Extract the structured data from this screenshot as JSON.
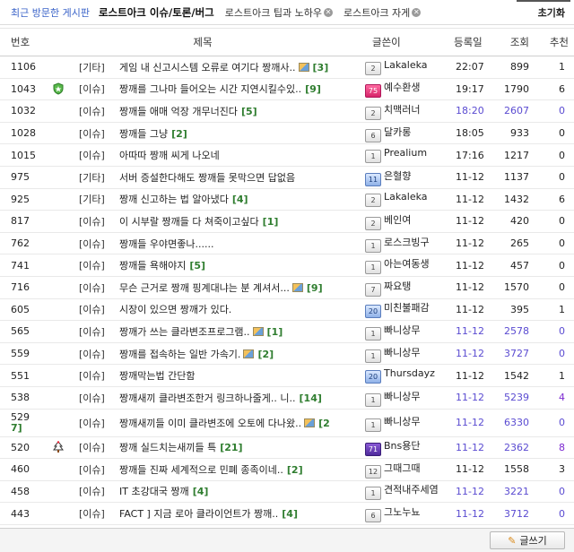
{
  "topbar": {
    "recent_label": "최근 방문한 게시판",
    "current_tab": "로스트아크 이슈/토론/버그",
    "tabs": [
      {
        "label": "로스트아크 팁과 노하우"
      },
      {
        "label": "로스트아크 자게"
      }
    ],
    "reset_label": "초기화"
  },
  "headers": {
    "num": "번호",
    "title": "제목",
    "writer": "글쓴이",
    "date": "등록일",
    "views": "조회",
    "rec": "추천"
  },
  "rows": [
    {
      "num": "1106",
      "cat": "[기타]",
      "title": "게임 내 신고시스템 오류로 여기다 짱깨사..",
      "comments": "[3]",
      "img": true,
      "badge": "",
      "writer": "Lakaleka",
      "lvl": "2",
      "lvl_style": "",
      "date": "22:07",
      "date_style": "",
      "views": "899",
      "views_style": "",
      "rec": "1",
      "rec_style": ""
    },
    {
      "num": "1043",
      "cat": "[이슈]",
      "title": "짱깨를 그나마 들어오는 시간 지연시킬수있..",
      "comments": "[9]",
      "img": false,
      "badge": "shield",
      "writer": "예수환생",
      "lvl": "75",
      "lvl_style": "pink",
      "date": "19:17",
      "date_style": "",
      "views": "1790",
      "views_style": "",
      "rec": "6",
      "rec_style": ""
    },
    {
      "num": "1032",
      "cat": "[이슈]",
      "title": "짱깨들 애매 억장 개무너진다",
      "comments": "[5]",
      "img": false,
      "badge": "",
      "writer": "치맥러너",
      "lvl": "2",
      "lvl_style": "",
      "date": "18:20",
      "date_style": "blue",
      "views": "2607",
      "views_style": "blue",
      "rec": "0",
      "rec_style": "blue"
    },
    {
      "num": "1028",
      "cat": "[이슈]",
      "title": "짱깨들 그냥",
      "comments": "[2]",
      "img": false,
      "badge": "",
      "writer": "달카롱",
      "lvl": "6",
      "lvl_style": "",
      "date": "18:05",
      "date_style": "",
      "views": "933",
      "views_style": "",
      "rec": "0",
      "rec_style": ""
    },
    {
      "num": "1015",
      "cat": "[이슈]",
      "title": "아따따 짱깨 씨게 나오네",
      "comments": "",
      "img": false,
      "badge": "",
      "writer": "Prealium",
      "lvl": "1",
      "lvl_style": "",
      "date": "17:16",
      "date_style": "",
      "views": "1217",
      "views_style": "",
      "rec": "0",
      "rec_style": ""
    },
    {
      "num": "975",
      "cat": "[기타]",
      "title": "서버 증설한다해도 짱깨들 못막으면 답없음",
      "comments": "",
      "img": false,
      "badge": "",
      "writer": "은혈향",
      "lvl": "11",
      "lvl_style": "blue",
      "date": "11-12",
      "date_style": "",
      "views": "1137",
      "views_style": "",
      "rec": "0",
      "rec_style": ""
    },
    {
      "num": "925",
      "cat": "[기타]",
      "title": "짱깨 신고하는 법 알아냈다",
      "comments": "[4]",
      "img": false,
      "badge": "",
      "writer": "Lakaleka",
      "lvl": "2",
      "lvl_style": "",
      "date": "11-12",
      "date_style": "",
      "views": "1432",
      "views_style": "",
      "rec": "6",
      "rec_style": ""
    },
    {
      "num": "817",
      "cat": "[이슈]",
      "title": "이 시부랄 짱깨들 다 쳐죽이고싶다",
      "comments": "[1]",
      "img": false,
      "badge": "",
      "writer": "베인여",
      "lvl": "2",
      "lvl_style": "",
      "date": "11-12",
      "date_style": "",
      "views": "420",
      "views_style": "",
      "rec": "0",
      "rec_style": ""
    },
    {
      "num": "762",
      "cat": "[이슈]",
      "title": "짱깨들 우야면좋나......",
      "comments": "",
      "img": false,
      "badge": "",
      "writer": "로스크빙구",
      "lvl": "1",
      "lvl_style": "",
      "date": "11-12",
      "date_style": "",
      "views": "265",
      "views_style": "",
      "rec": "0",
      "rec_style": ""
    },
    {
      "num": "741",
      "cat": "[이슈]",
      "title": "짱깨들 욕해야지",
      "comments": "[5]",
      "img": false,
      "badge": "",
      "writer": "아는여동생",
      "lvl": "1",
      "lvl_style": "",
      "date": "11-12",
      "date_style": "",
      "views": "457",
      "views_style": "",
      "rec": "0",
      "rec_style": ""
    },
    {
      "num": "716",
      "cat": "[이슈]",
      "title": "무슨 근거로 짱깨 핑계대냐는 분 계셔서...",
      "comments": "[9]",
      "img": true,
      "badge": "",
      "writer": "짜요탱",
      "lvl": "7",
      "lvl_style": "",
      "date": "11-12",
      "date_style": "",
      "views": "1570",
      "views_style": "",
      "rec": "0",
      "rec_style": ""
    },
    {
      "num": "605",
      "cat": "[이슈]",
      "title": "시장이 있으면 짱깨가 있다.",
      "comments": "",
      "img": false,
      "badge": "",
      "writer": "미친불패감",
      "lvl": "20",
      "lvl_style": "blue",
      "date": "11-12",
      "date_style": "",
      "views": "395",
      "views_style": "",
      "rec": "1",
      "rec_style": ""
    },
    {
      "num": "565",
      "cat": "[이슈]",
      "title": "짱깨가 쓰는 클라변조프로그램..",
      "comments": "[1]",
      "img": true,
      "badge": "",
      "writer": "빠니상무",
      "lvl": "1",
      "lvl_style": "",
      "date": "11-12",
      "date_style": "blue",
      "views": "2578",
      "views_style": "blue",
      "rec": "0",
      "rec_style": "blue"
    },
    {
      "num": "559",
      "cat": "[이슈]",
      "title": "짱깨를 접속하는 일반 가속기.",
      "comments": "[2]",
      "img": true,
      "badge": "",
      "writer": "빠니상무",
      "lvl": "1",
      "lvl_style": "",
      "date": "11-12",
      "date_style": "blue",
      "views": "3727",
      "views_style": "blue",
      "rec": "0",
      "rec_style": "blue"
    },
    {
      "num": "551",
      "cat": "[이슈]",
      "title": "짱깨막는법 간단함",
      "comments": "",
      "img": false,
      "badge": "",
      "writer": "Thursdayz",
      "lvl": "20",
      "lvl_style": "blue",
      "date": "11-12",
      "date_style": "",
      "views": "1542",
      "views_style": "",
      "rec": "1",
      "rec_style": ""
    },
    {
      "num": "538",
      "cat": "[이슈]",
      "title": "짱깨새끼 클라변조한거 링크하나줄게.. 니..",
      "comments": "[14]",
      "img": false,
      "badge": "",
      "writer": "빠니상무",
      "lvl": "1",
      "lvl_style": "",
      "date": "11-12",
      "date_style": "blue",
      "views": "5239",
      "views_style": "blue",
      "rec": "4",
      "rec_style": "red"
    },
    {
      "num": "529",
      "num_suffix": "7]",
      "cat": "[이슈]",
      "title": "짱깨새끼들 이미 클라변조에 오토에 다나왔..",
      "comments": "[2",
      "img": true,
      "badge": "",
      "writer": "빠니상무",
      "lvl": "1",
      "lvl_style": "",
      "date": "11-12",
      "date_style": "blue",
      "views": "6330",
      "views_style": "blue",
      "rec": "0",
      "rec_style": "blue",
      "tall": true
    },
    {
      "num": "520",
      "cat": "[이슈]",
      "title": "짱깨 실드치는새끼들 특",
      "comments": "[21]",
      "img": false,
      "badge": "tree",
      "writer": "Bns용단",
      "lvl": "71",
      "lvl_style": "purple",
      "date": "11-12",
      "date_style": "blue",
      "views": "2362",
      "views_style": "blue",
      "rec": "8",
      "rec_style": "red"
    },
    {
      "num": "460",
      "cat": "[이슈]",
      "title": "짱깨들 진짜 세계적으로 민폐 종족이네..",
      "comments": "[2]",
      "img": false,
      "badge": "",
      "writer": "그때그때",
      "lvl": "12",
      "lvl_style": "",
      "date": "11-12",
      "date_style": "",
      "views": "1558",
      "views_style": "",
      "rec": "3",
      "rec_style": ""
    },
    {
      "num": "458",
      "cat": "[이슈]",
      "title": "IT 초강대국 짱깨",
      "comments": "[4]",
      "img": false,
      "badge": "",
      "writer": "견적내주세염",
      "lvl": "1",
      "lvl_style": "",
      "date": "11-12",
      "date_style": "blue",
      "views": "3221",
      "views_style": "blue",
      "rec": "0",
      "rec_style": "blue"
    },
    {
      "num": "443",
      "cat": "[이슈]",
      "title": "FACT ] 지금 로아 클라이언트가 짱깨..",
      "comments": "[4]",
      "img": false,
      "badge": "",
      "writer": "그노누뇨",
      "lvl": "6",
      "lvl_style": "",
      "date": "11-12",
      "date_style": "blue",
      "views": "3712",
      "views_style": "blue",
      "rec": "0",
      "rec_style": "blue"
    }
  ],
  "footer": {
    "write_label": "글쓰기"
  }
}
